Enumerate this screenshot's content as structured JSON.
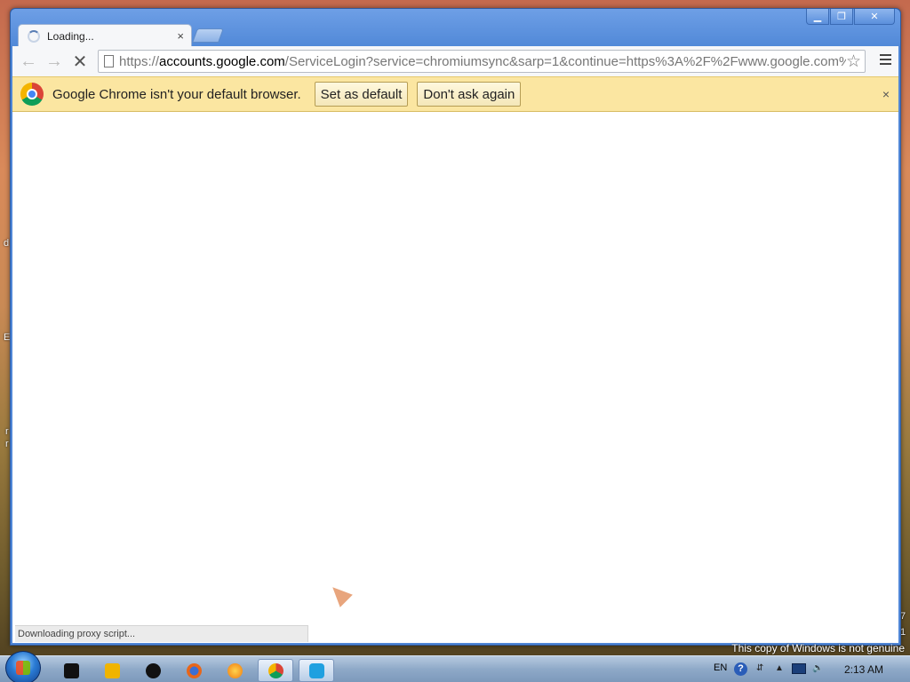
{
  "desktop": {
    "side_letters": [
      "d",
      "E",
      "r",
      "r",
      "7",
      "1"
    ],
    "genuine_notice": "This copy of Windows is not genuine"
  },
  "window": {
    "controls": [
      "minimize",
      "restore",
      "close"
    ]
  },
  "tab": {
    "title": "Loading...",
    "close_symbol": "×"
  },
  "toolbar": {
    "url_scheme": "https://",
    "url_host": "accounts.google.com",
    "url_rest": "/ServiceLogin?service=chromiumsync&sarp=1&continue=https%3A%2F%2Fwww.google.com%"
  },
  "infobar": {
    "message": "Google Chrome isn't your default browser.",
    "set_default_label": "Set as default",
    "dont_ask_label": "Don't ask again",
    "close_symbol": "×"
  },
  "status": {
    "text": "Downloading proxy script..."
  },
  "taskbar": {
    "items": [
      "app",
      "media-player",
      "app-dark",
      "firefox",
      "app-orange",
      "chrome",
      "skype"
    ],
    "active": "chrome",
    "language": "EN",
    "help_symbol": "?",
    "clock": "2:13 AM"
  },
  "colors": {
    "window_frame": "#4f86d6",
    "infobar_bg": "#fbe6a1",
    "status_bg": "#ebebeb"
  }
}
